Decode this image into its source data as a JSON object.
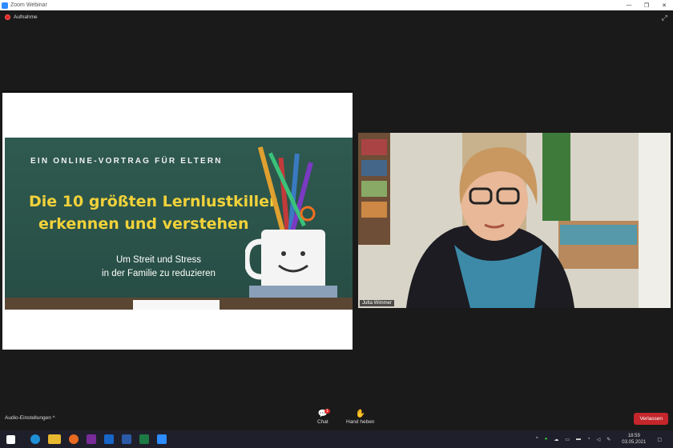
{
  "window": {
    "title": "Zoom Webinar",
    "minimize": "—",
    "maximize": "❐",
    "close": "✕"
  },
  "recording": {
    "label": "Aufnahme"
  },
  "slide": {
    "kicker": "EIN ONLINE-VORTRAG FÜR ELTERN",
    "headline_line1": "Die 10 größten Lernlustkiller",
    "headline_line2": "erkennen und verstehen",
    "sub_line1": "Um Streit und Stress",
    "sub_line2": "in der Familie zu reduzieren"
  },
  "participant": {
    "name": "Jutta Wimmer"
  },
  "toolbar": {
    "audio_settings": "Audio-Einstellungen",
    "chat_label": "Chat",
    "chat_badge": "1",
    "raise_hand_label": "Hand heben",
    "leave_label": "Verlassen"
  },
  "taskbar": {
    "time": "18:59",
    "date": "03.05.2021"
  },
  "colors": {
    "accent": "#2D8CFF",
    "leave": "#c4262b",
    "headline": "#f2d23a"
  }
}
